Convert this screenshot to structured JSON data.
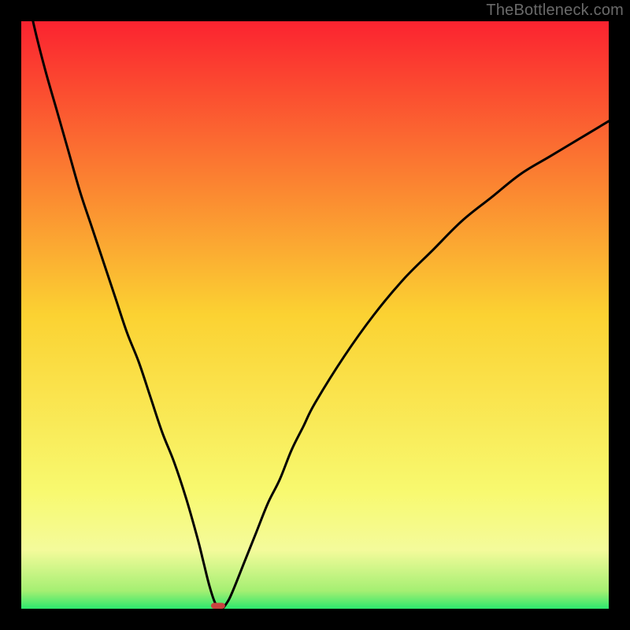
{
  "attribution": "TheBottleneck.com",
  "colors": {
    "bg": "#000000",
    "gradient_top": "#FB2330",
    "gradient_mid": "#FBD232",
    "gradient_bottom_band": "#F4FB9B",
    "gradient_green": "#2CE76D",
    "curve": "#000000",
    "marker": "#C9443F",
    "attribution": "#6A6A6A"
  },
  "chart_data": {
    "type": "line",
    "title": "",
    "xlabel": "",
    "ylabel": "",
    "xlim": [
      0,
      100
    ],
    "ylim": [
      0,
      100
    ],
    "x": [
      0,
      2,
      4,
      6,
      8,
      10,
      12,
      14,
      16,
      18,
      20,
      22,
      24,
      26,
      28,
      30,
      31,
      32,
      33,
      34,
      35,
      36,
      38,
      40,
      42,
      44,
      46,
      48,
      50,
      55,
      60,
      65,
      70,
      75,
      80,
      85,
      90,
      95,
      100
    ],
    "values": [
      110,
      100,
      92,
      85,
      78,
      71,
      65,
      59,
      53,
      47,
      42,
      36,
      30,
      25,
      19,
      12,
      8,
      4,
      1,
      0,
      1,
      3,
      8,
      13,
      18,
      22,
      27,
      31,
      35,
      43,
      50,
      56,
      61,
      66,
      70,
      74,
      77,
      80,
      83
    ],
    "annotations": [
      {
        "type": "marker",
        "x": 33.5,
        "y": 0.5,
        "w": 2.4,
        "h": 1.0,
        "color": "#C9443F"
      }
    ],
    "background_gradient": [
      {
        "offset": 0.0,
        "color": "#FB2330"
      },
      {
        "offset": 0.5,
        "color": "#FBD232"
      },
      {
        "offset": 0.8,
        "color": "#F8F96F"
      },
      {
        "offset": 0.9,
        "color": "#F4FB9B"
      },
      {
        "offset": 0.97,
        "color": "#A4EF72"
      },
      {
        "offset": 1.0,
        "color": "#2CE76D"
      }
    ]
  }
}
